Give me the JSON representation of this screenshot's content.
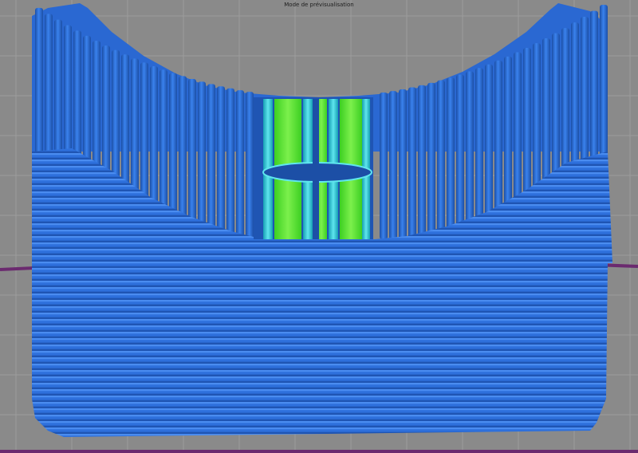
{
  "viewport": {
    "title": "Mode de prévisualisation"
  },
  "colors": {
    "background": "#8a8a8a",
    "grid": "#9c9c9c",
    "bed_outline": "#6b2a6f",
    "perimeter_blue": "#2e6fd8",
    "perimeter_dark": "#1c4fa6",
    "perimeter_light": "#4a8cf0",
    "inner_cyan": "#1fc9d9",
    "infill_green": "#55e832",
    "infill_dark_green": "#2fae1c"
  },
  "scene_object": "print-preview-model"
}
